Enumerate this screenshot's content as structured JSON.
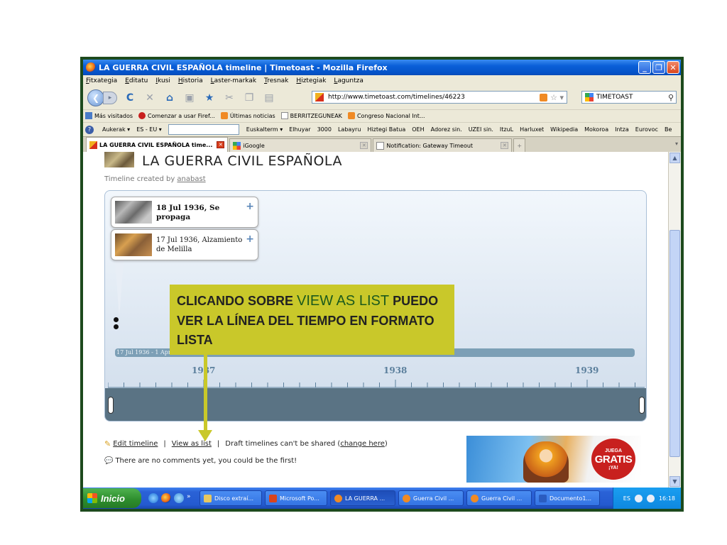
{
  "window": {
    "title": "LA GUERRA CIVIL ESPAÑOLA timeline | Timetoast - Mozilla Firefox",
    "minimize": "_",
    "maximize": "❐",
    "close": "✕"
  },
  "menu": [
    "Fitxategia",
    "Editatu",
    "Ikusi",
    "Historia",
    "Laster-markak",
    "Tresnak",
    "Hiztegiak",
    "Laguntza"
  ],
  "nav": {
    "back_glyph": "❮",
    "forward_glyph": "▸",
    "reload_glyph": "C",
    "stop_glyph": "✕",
    "home_glyph": "⌂",
    "url": "http://www.timetoast.com/timelines/46223",
    "search_engine": "TIMETOAST",
    "search_glyph": "⚲",
    "star_glyph": "☆ ▾"
  },
  "bookmarks": [
    {
      "icon": "blue",
      "label": "Más visitados"
    },
    {
      "icon": "red",
      "label": "Comenzar a usar Firef..."
    },
    {
      "icon": "rss",
      "label": "Últimas noticias"
    },
    {
      "icon": "page",
      "label": "BERRITZEGUNEAK"
    },
    {
      "icon": "rss",
      "label": "Congreso Nacional Int..."
    }
  ],
  "toolbar2": {
    "help": "?",
    "links": [
      "Aukerak ▾",
      "ES - EU ▾"
    ],
    "links_after": [
      "Euskalterm ▾",
      "Elhuyar",
      "3000",
      "Labayru",
      "Hiztegi Batua",
      "OEH",
      "Adorez sin.",
      "UZEI sin.",
      "ItzuL",
      "Harluxet",
      "Wikipedia",
      "Mokoroa",
      "Intza",
      "Eurovoc",
      "Be"
    ]
  },
  "tabs": [
    {
      "label": "LA GUERRA CIVIL ESPAÑOLA time...",
      "active": true,
      "close": "✕"
    },
    {
      "label": "iGoogle",
      "active": false,
      "close": "✕"
    },
    {
      "label": "Notification: Gateway Timeout",
      "active": false,
      "close": "✕"
    }
  ],
  "tab_new": "+",
  "tab_list": "▾",
  "page": {
    "title": "LA GUERRA CIVIL ESPAÑOLA",
    "subtitle_prefix": "Timeline created by ",
    "author": "anabast"
  },
  "timeline": {
    "events": [
      {
        "text": "18 Jul 1936, Se propaga"
      },
      {
        "text": "17 Jul 1936, Alzamiento de Melilla"
      }
    ],
    "plus": "+",
    "span_label": "17 Jul 1936 - 1 Apr 1939  GUERRA CIVIL ESPAÑOLA",
    "years": [
      "1937",
      "1938",
      "1939"
    ]
  },
  "callout": {
    "part1": "CLICANDO SOBRE ",
    "highlight": "VIEW AS LIST",
    "part2": " PUEDO VER LA LÍNEA DEL TIEMPO EN FORMATO LISTA"
  },
  "actions": {
    "edit": "Edit timeline",
    "separator": "|",
    "view_list": "View as list",
    "draft_text": "Draft timelines can't be shared (",
    "change": "change here",
    "draft_close": ")"
  },
  "comments": "There are no comments yet, you could be the first!",
  "ad": {
    "line1": "JUEGA",
    "line2": "GRATIS",
    "line3": "¡YA!"
  },
  "taskbar": {
    "start": "Inicio",
    "more": "»",
    "tasks": [
      {
        "label": "Disco extraí...",
        "color": "#e8c860"
      },
      {
        "label": "Microsoft Po...",
        "color": "#d8441e"
      },
      {
        "label": "LA GUERRA ...",
        "color": "#f08a24",
        "active": true
      },
      {
        "label": "Guerra Civil ...",
        "color": "#f08a24"
      },
      {
        "label": "Guerra Civil ...",
        "color": "#f08a24"
      },
      {
        "label": "Documento1...",
        "color": "#2a5cc0"
      }
    ],
    "lang": "ES",
    "time": "16:18"
  },
  "scroll": {
    "up": "▲",
    "down": "▼"
  }
}
